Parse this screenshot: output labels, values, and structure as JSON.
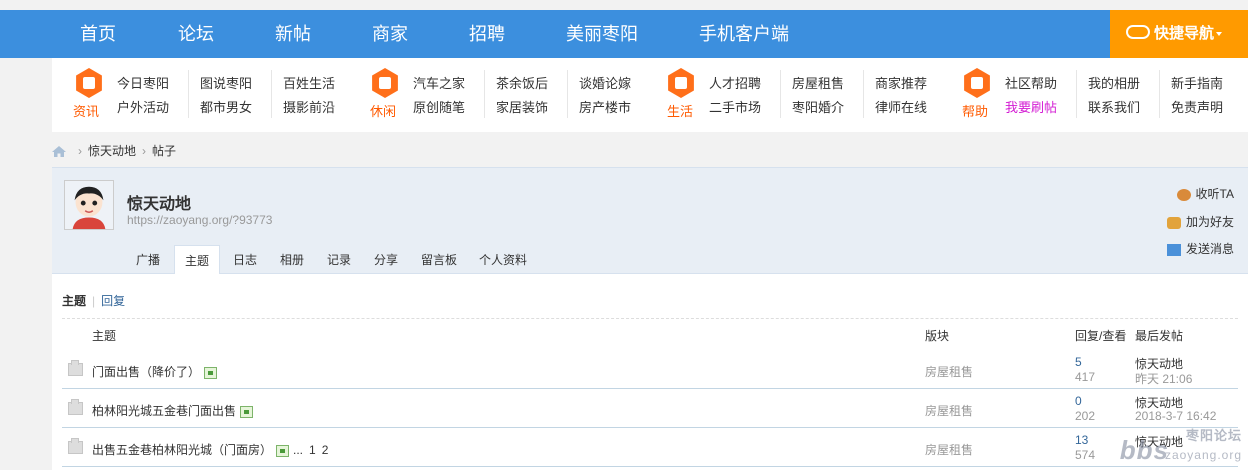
{
  "topnav": {
    "items": [
      "首页",
      "论坛",
      "新帖",
      "商家",
      "招聘",
      "美丽枣阳",
      "手机客户端"
    ],
    "quick_nav": "快捷导航"
  },
  "quicklinks": {
    "groups": [
      {
        "category": "资讯",
        "links": [
          [
            "今日枣阳",
            "户外活动"
          ],
          [
            "图说枣阳",
            "都市男女"
          ],
          [
            "百姓生活",
            "摄影前沿"
          ]
        ]
      },
      {
        "category": "休闲",
        "links": [
          [
            "汽车之家",
            "原创随笔"
          ],
          [
            "茶余饭后",
            "家居装饰"
          ],
          [
            "谈婚论嫁",
            "房产楼市"
          ]
        ]
      },
      {
        "category": "生活",
        "links": [
          [
            "人才招聘",
            "二手市场"
          ],
          [
            "房屋租售",
            "枣阳婚介"
          ],
          [
            "商家推荐",
            "律师在线"
          ]
        ]
      },
      {
        "category": "帮助",
        "links": [
          [
            "社区帮助",
            "我要刷帖"
          ],
          [
            "我的相册",
            "联系我们"
          ],
          [
            "新手指南",
            "免责声明"
          ]
        ]
      }
    ]
  },
  "breadcrumb": {
    "items": [
      "惊天动地",
      "帖子"
    ]
  },
  "profile": {
    "name": "惊天动地",
    "url": "https://zaoyang.org/?93773",
    "tabs": [
      "广播",
      "主题",
      "日志",
      "相册",
      "记录",
      "分享",
      "留言板",
      "个人资料"
    ],
    "active_tab": "主题",
    "actions": [
      "收听TA",
      "加为好友",
      "发送消息"
    ]
  },
  "content": {
    "subtabs": [
      "主题",
      "回复"
    ],
    "headers": {
      "subject": "主题",
      "forum": "版块",
      "replies_views": "回复/查看",
      "last_post": "最后发帖"
    },
    "rows": [
      {
        "title": "门面出售（降价了）",
        "has_image": true,
        "pages": [],
        "forum": "房屋租售",
        "replies": "5",
        "views": "417",
        "last_user": "惊天动地",
        "last_time": "昨天 21:06"
      },
      {
        "title": "柏林阳光城五金巷门面出售",
        "has_image": true,
        "pages": [],
        "forum": "房屋租售",
        "replies": "0",
        "views": "202",
        "last_user": "惊天动地",
        "last_time": "2018-3-7 16:42"
      },
      {
        "title": "出售五金巷柏林阳光城（门面房）",
        "has_image": true,
        "pages": [
          "...",
          "1",
          "2"
        ],
        "forum": "房屋租售",
        "replies": "13",
        "views": "574",
        "last_user": "惊天动地",
        "last_time": ""
      }
    ]
  },
  "watermark": {
    "main": "bbs",
    "site": "枣阳论坛",
    "domain": "zaoyang.org"
  },
  "colors": {
    "nav_blue": "#3c8fde",
    "quick_orange": "#ff9a00",
    "icon_orange": "#ff6f1a"
  }
}
